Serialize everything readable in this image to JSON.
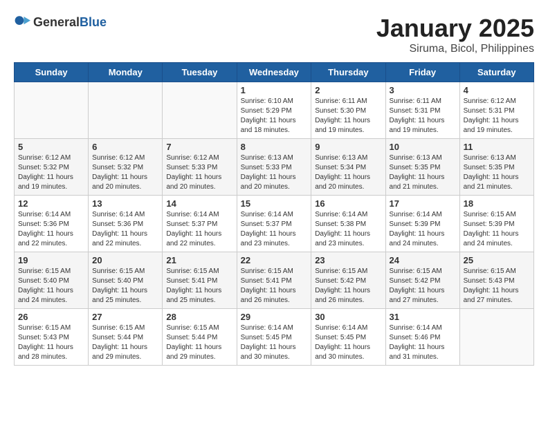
{
  "logo": {
    "text_general": "General",
    "text_blue": "Blue"
  },
  "title": {
    "month": "January 2025",
    "location": "Siruma, Bicol, Philippines"
  },
  "weekdays": [
    "Sunday",
    "Monday",
    "Tuesday",
    "Wednesday",
    "Thursday",
    "Friday",
    "Saturday"
  ],
  "weeks": [
    [
      {
        "day": "",
        "sunrise": "",
        "sunset": "",
        "daylight": ""
      },
      {
        "day": "",
        "sunrise": "",
        "sunset": "",
        "daylight": ""
      },
      {
        "day": "",
        "sunrise": "",
        "sunset": "",
        "daylight": ""
      },
      {
        "day": "1",
        "sunrise": "Sunrise: 6:10 AM",
        "sunset": "Sunset: 5:29 PM",
        "daylight": "Daylight: 11 hours and 18 minutes."
      },
      {
        "day": "2",
        "sunrise": "Sunrise: 6:11 AM",
        "sunset": "Sunset: 5:30 PM",
        "daylight": "Daylight: 11 hours and 19 minutes."
      },
      {
        "day": "3",
        "sunrise": "Sunrise: 6:11 AM",
        "sunset": "Sunset: 5:31 PM",
        "daylight": "Daylight: 11 hours and 19 minutes."
      },
      {
        "day": "4",
        "sunrise": "Sunrise: 6:12 AM",
        "sunset": "Sunset: 5:31 PM",
        "daylight": "Daylight: 11 hours and 19 minutes."
      }
    ],
    [
      {
        "day": "5",
        "sunrise": "Sunrise: 6:12 AM",
        "sunset": "Sunset: 5:32 PM",
        "daylight": "Daylight: 11 hours and 19 minutes."
      },
      {
        "day": "6",
        "sunrise": "Sunrise: 6:12 AM",
        "sunset": "Sunset: 5:32 PM",
        "daylight": "Daylight: 11 hours and 20 minutes."
      },
      {
        "day": "7",
        "sunrise": "Sunrise: 6:12 AM",
        "sunset": "Sunset: 5:33 PM",
        "daylight": "Daylight: 11 hours and 20 minutes."
      },
      {
        "day": "8",
        "sunrise": "Sunrise: 6:13 AM",
        "sunset": "Sunset: 5:33 PM",
        "daylight": "Daylight: 11 hours and 20 minutes."
      },
      {
        "day": "9",
        "sunrise": "Sunrise: 6:13 AM",
        "sunset": "Sunset: 5:34 PM",
        "daylight": "Daylight: 11 hours and 20 minutes."
      },
      {
        "day": "10",
        "sunrise": "Sunrise: 6:13 AM",
        "sunset": "Sunset: 5:35 PM",
        "daylight": "Daylight: 11 hours and 21 minutes."
      },
      {
        "day": "11",
        "sunrise": "Sunrise: 6:13 AM",
        "sunset": "Sunset: 5:35 PM",
        "daylight": "Daylight: 11 hours and 21 minutes."
      }
    ],
    [
      {
        "day": "12",
        "sunrise": "Sunrise: 6:14 AM",
        "sunset": "Sunset: 5:36 PM",
        "daylight": "Daylight: 11 hours and 22 minutes."
      },
      {
        "day": "13",
        "sunrise": "Sunrise: 6:14 AM",
        "sunset": "Sunset: 5:36 PM",
        "daylight": "Daylight: 11 hours and 22 minutes."
      },
      {
        "day": "14",
        "sunrise": "Sunrise: 6:14 AM",
        "sunset": "Sunset: 5:37 PM",
        "daylight": "Daylight: 11 hours and 22 minutes."
      },
      {
        "day": "15",
        "sunrise": "Sunrise: 6:14 AM",
        "sunset": "Sunset: 5:37 PM",
        "daylight": "Daylight: 11 hours and 23 minutes."
      },
      {
        "day": "16",
        "sunrise": "Sunrise: 6:14 AM",
        "sunset": "Sunset: 5:38 PM",
        "daylight": "Daylight: 11 hours and 23 minutes."
      },
      {
        "day": "17",
        "sunrise": "Sunrise: 6:14 AM",
        "sunset": "Sunset: 5:39 PM",
        "daylight": "Daylight: 11 hours and 24 minutes."
      },
      {
        "day": "18",
        "sunrise": "Sunrise: 6:15 AM",
        "sunset": "Sunset: 5:39 PM",
        "daylight": "Daylight: 11 hours and 24 minutes."
      }
    ],
    [
      {
        "day": "19",
        "sunrise": "Sunrise: 6:15 AM",
        "sunset": "Sunset: 5:40 PM",
        "daylight": "Daylight: 11 hours and 24 minutes."
      },
      {
        "day": "20",
        "sunrise": "Sunrise: 6:15 AM",
        "sunset": "Sunset: 5:40 PM",
        "daylight": "Daylight: 11 hours and 25 minutes."
      },
      {
        "day": "21",
        "sunrise": "Sunrise: 6:15 AM",
        "sunset": "Sunset: 5:41 PM",
        "daylight": "Daylight: 11 hours and 25 minutes."
      },
      {
        "day": "22",
        "sunrise": "Sunrise: 6:15 AM",
        "sunset": "Sunset: 5:41 PM",
        "daylight": "Daylight: 11 hours and 26 minutes."
      },
      {
        "day": "23",
        "sunrise": "Sunrise: 6:15 AM",
        "sunset": "Sunset: 5:42 PM",
        "daylight": "Daylight: 11 hours and 26 minutes."
      },
      {
        "day": "24",
        "sunrise": "Sunrise: 6:15 AM",
        "sunset": "Sunset: 5:42 PM",
        "daylight": "Daylight: 11 hours and 27 minutes."
      },
      {
        "day": "25",
        "sunrise": "Sunrise: 6:15 AM",
        "sunset": "Sunset: 5:43 PM",
        "daylight": "Daylight: 11 hours and 27 minutes."
      }
    ],
    [
      {
        "day": "26",
        "sunrise": "Sunrise: 6:15 AM",
        "sunset": "Sunset: 5:43 PM",
        "daylight": "Daylight: 11 hours and 28 minutes."
      },
      {
        "day": "27",
        "sunrise": "Sunrise: 6:15 AM",
        "sunset": "Sunset: 5:44 PM",
        "daylight": "Daylight: 11 hours and 29 minutes."
      },
      {
        "day": "28",
        "sunrise": "Sunrise: 6:15 AM",
        "sunset": "Sunset: 5:44 PM",
        "daylight": "Daylight: 11 hours and 29 minutes."
      },
      {
        "day": "29",
        "sunrise": "Sunrise: 6:14 AM",
        "sunset": "Sunset: 5:45 PM",
        "daylight": "Daylight: 11 hours and 30 minutes."
      },
      {
        "day": "30",
        "sunrise": "Sunrise: 6:14 AM",
        "sunset": "Sunset: 5:45 PM",
        "daylight": "Daylight: 11 hours and 30 minutes."
      },
      {
        "day": "31",
        "sunrise": "Sunrise: 6:14 AM",
        "sunset": "Sunset: 5:46 PM",
        "daylight": "Daylight: 11 hours and 31 minutes."
      },
      {
        "day": "",
        "sunrise": "",
        "sunset": "",
        "daylight": ""
      }
    ]
  ]
}
